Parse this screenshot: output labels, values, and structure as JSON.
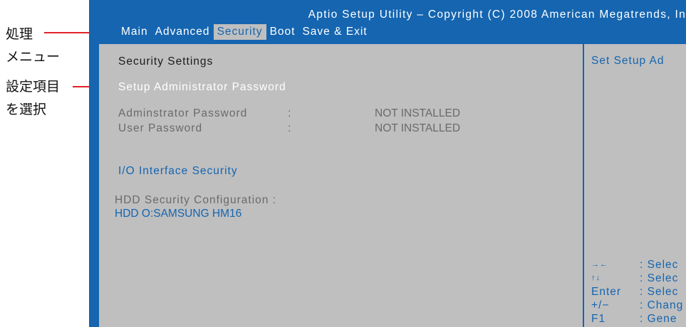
{
  "annotations": {
    "process_menu_line1": "処理",
    "process_menu_line2": "メニュー",
    "select_item_line1": "設定項目",
    "select_item_line2": "を選択"
  },
  "bios": {
    "title": "Aptio Setup Utility – Copyright (C) 2008 American Megatrends, In",
    "menu": [
      "Main",
      "Advanced",
      "Security",
      "Boot",
      "Save & Exit"
    ],
    "active_menu": "Security",
    "section_title": "Security Settings",
    "selected_item": "Setup Administrator Password",
    "admin_password": {
      "label": "Adminstrator Password",
      "sep": ":",
      "value": "NOT INSTALLED"
    },
    "user_password": {
      "label": "User Password",
      "sep": ":",
      "value": "NOT INSTALLED"
    },
    "io_security": "I/O Interface Security",
    "hdd_config_label": "HDD Security Configuration :",
    "hdd_item": "HDD O:SAMSUNG HM16",
    "help_text": "Set Setup Ad",
    "keys": [
      {
        "key": "→←",
        "desc": ": Selec"
      },
      {
        "key": "↑↓",
        "desc": ": Selec"
      },
      {
        "key": "Enter",
        "desc": ": Selec"
      },
      {
        "key": "+/−",
        "desc": ": Chang"
      },
      {
        "key": "F1",
        "desc": ": Gene"
      }
    ]
  },
  "colors": {
    "bios_blue": "#1565b0",
    "panel_gray": "#bfbfbf",
    "annotation_red": "#e2232a"
  }
}
